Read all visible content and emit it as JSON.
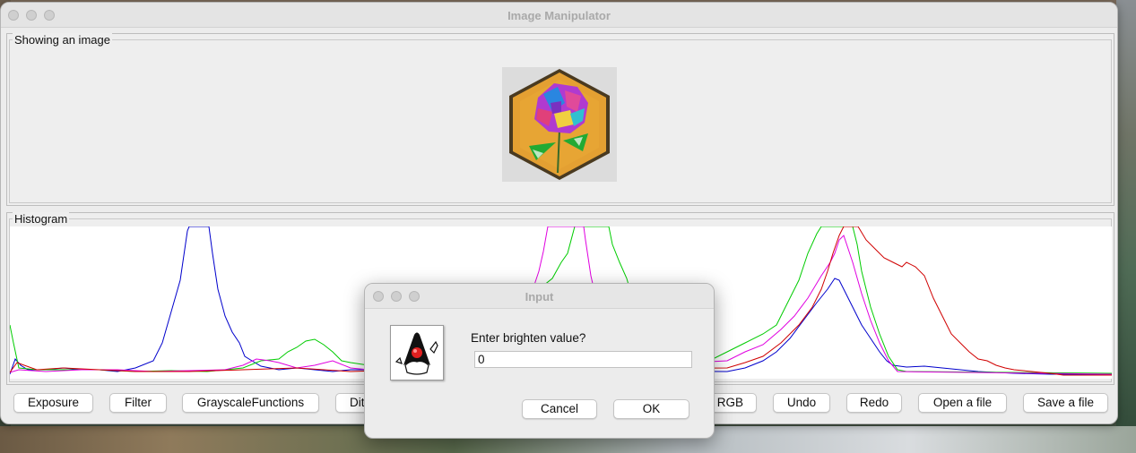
{
  "window": {
    "title": "Image Manipulator"
  },
  "image_panel": {
    "title": "Showing an image"
  },
  "histogram_panel": {
    "title": "Histogram",
    "colors": {
      "red": "#d00000",
      "green": "#00cc00",
      "blue": "#0000cc",
      "magenta": "#e000e0"
    }
  },
  "toolbar": {
    "buttons": [
      "Exposure",
      "Filter",
      "GrayscaleFunctions",
      "Dithering",
      "",
      "",
      "e RGB",
      "Undo",
      "Redo",
      "Open a file",
      "Save a file"
    ]
  },
  "dialog": {
    "title": "Input",
    "prompt": "Enter brighten value?",
    "input_value": "0",
    "cancel_label": "Cancel",
    "ok_label": "OK"
  }
}
